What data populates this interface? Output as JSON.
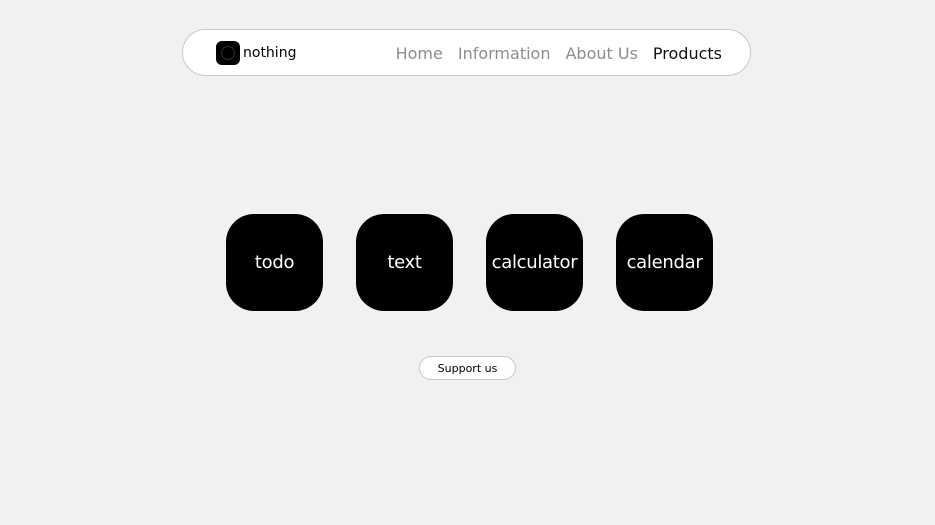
{
  "brand": {
    "name": "nothing",
    "logo_icon": "nothing-logo-icon"
  },
  "nav": {
    "links": [
      {
        "label": "Home",
        "active": false
      },
      {
        "label": "Information",
        "active": false
      },
      {
        "label": "About Us",
        "active": false
      },
      {
        "label": "Products",
        "active": true
      }
    ]
  },
  "apps": [
    {
      "label": "todo"
    },
    {
      "label": "text"
    },
    {
      "label": "calculator"
    },
    {
      "label": "calendar"
    }
  ],
  "support": {
    "label": "Support us"
  },
  "colors": {
    "background": "#f1f1f1",
    "tile": "#000000",
    "nav_inactive": "#8d8d8d",
    "nav_active": "#111111"
  }
}
